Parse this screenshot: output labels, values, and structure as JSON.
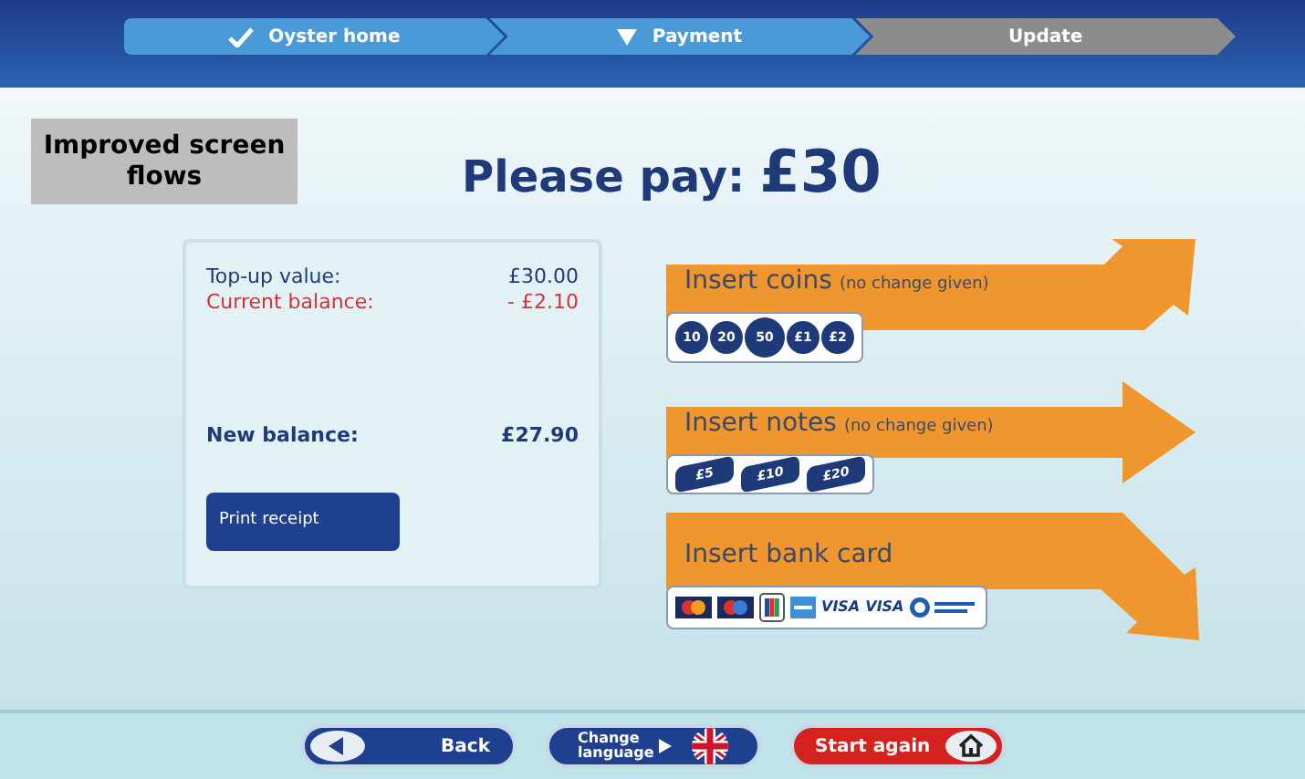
{
  "steps": [
    {
      "label": "Oyster home",
      "kind": "done"
    },
    {
      "label": "Payment",
      "kind": "current"
    },
    {
      "label": "Update",
      "kind": "pending"
    }
  ],
  "caption": "Improved screen flows",
  "heading": {
    "label": "Please pay:",
    "amount": "£30"
  },
  "summary": {
    "rows": [
      {
        "label": "Top-up value:",
        "value": "£30.00",
        "negative": false
      },
      {
        "label": "Current balance:",
        "value": "- £2.10",
        "negative": true
      }
    ],
    "total": {
      "label": "New balance:",
      "value": "£27.90"
    },
    "button": "Print receipt"
  },
  "options": [
    {
      "title": "Insert coins",
      "note": "(no change given)",
      "kind": "coins",
      "items": [
        "10",
        "20",
        "50",
        "£1",
        "£2"
      ]
    },
    {
      "title": "Insert notes",
      "note": "(no change given)",
      "kind": "notes",
      "items": [
        "£5",
        "£10",
        "£20"
      ]
    },
    {
      "title": "Insert bank card",
      "kind": "cards",
      "items": [
        "VISA",
        "VISA"
      ]
    }
  ],
  "footer": [
    {
      "label": "Back",
      "kind": "back"
    },
    {
      "label": "Change language",
      "kind": "language"
    },
    {
      "label": "Start again",
      "kind": "restart"
    }
  ]
}
